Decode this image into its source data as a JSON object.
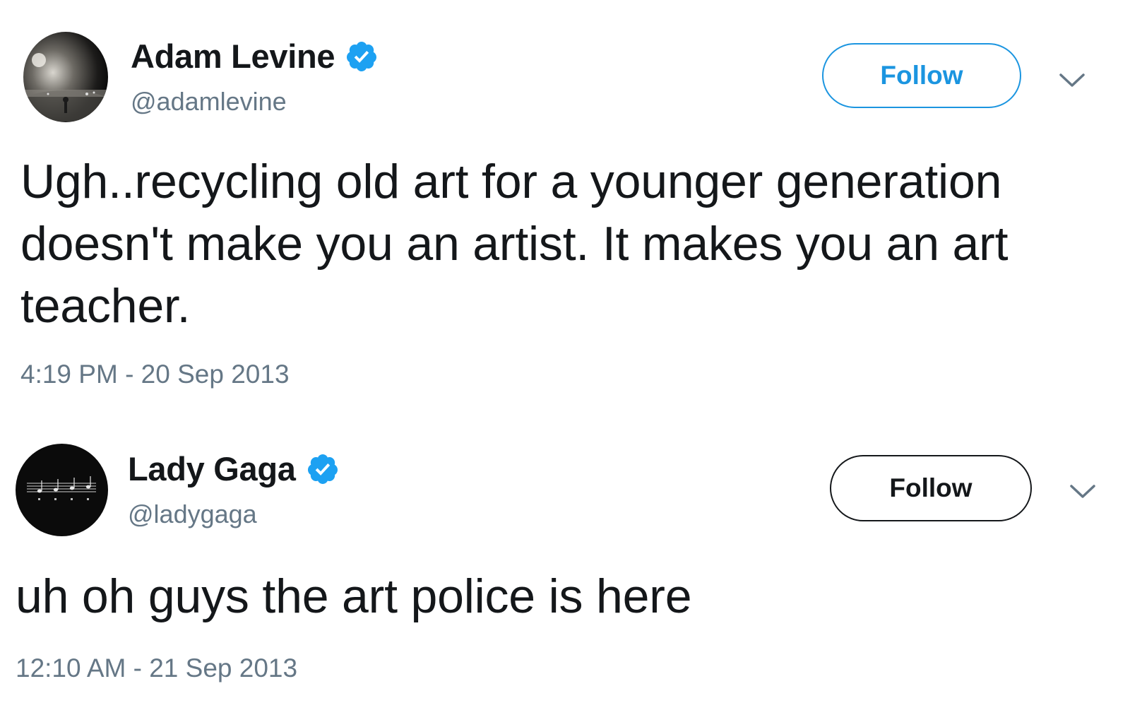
{
  "tweets": [
    {
      "display_name": "Adam Levine",
      "verified_icon": "verified-badge-icon",
      "handle": "@adamlevine",
      "follow_label": "Follow",
      "follow_style": "outlined-blue",
      "menu_icon": "chevron-down-icon",
      "text": "Ugh..recycling old art for a younger generation doesn't make you an artist. It makes you an art teacher.",
      "timestamp": "4:19 PM - 20 Sep 2013"
    },
    {
      "display_name": "Lady Gaga",
      "verified_icon": "verified-badge-icon",
      "handle": "@ladygaga",
      "follow_label": "Follow",
      "follow_style": "outlined-black",
      "menu_icon": "chevron-down-icon",
      "text": "uh oh guys the art police is here",
      "timestamp": "12:10 AM - 21 Sep 2013"
    }
  ],
  "colors": {
    "verified_blue": "#1da1f2",
    "follow_blue": "#1b95e0",
    "text_primary": "#14171a",
    "text_secondary": "#657786"
  }
}
